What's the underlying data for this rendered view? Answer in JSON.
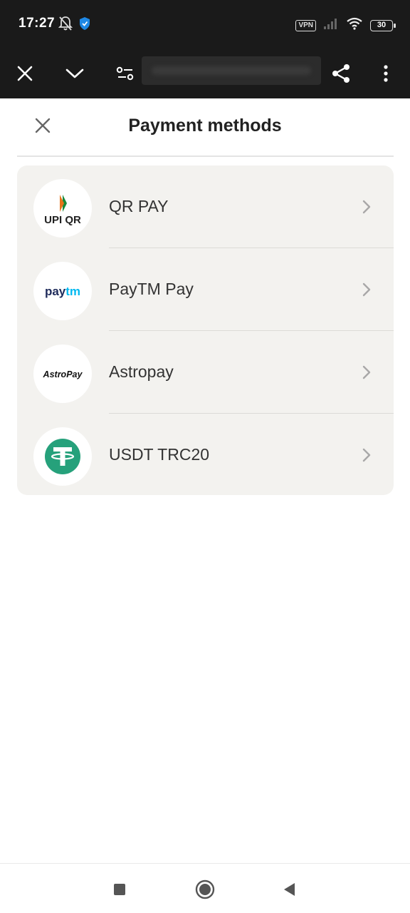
{
  "status_bar": {
    "time": "17:27",
    "vpn": "VPN",
    "battery": "30"
  },
  "browser": {
    "url": ""
  },
  "sheet": {
    "title": "Payment methods"
  },
  "methods": [
    {
      "label": "QR PAY",
      "logo_text": "UPI QR",
      "icon": "upi-qr-logo"
    },
    {
      "label": "PayTM Pay",
      "logo_text": "paytm",
      "icon": "paytm-logo"
    },
    {
      "label": "Astropay",
      "logo_text": "AstroPay",
      "icon": "astropay-logo"
    },
    {
      "label": "USDT TRC20",
      "logo_text": "",
      "icon": "tether-logo"
    }
  ],
  "colors": {
    "top_bar": "#1a1a1a",
    "card_bg": "#f3f2ef",
    "tether_green": "#26a17b",
    "paytm_dark": "#1e2a5a",
    "paytm_light": "#00b9f1",
    "upi_orange": "#e8731a",
    "upi_green": "#1a8a3a"
  }
}
